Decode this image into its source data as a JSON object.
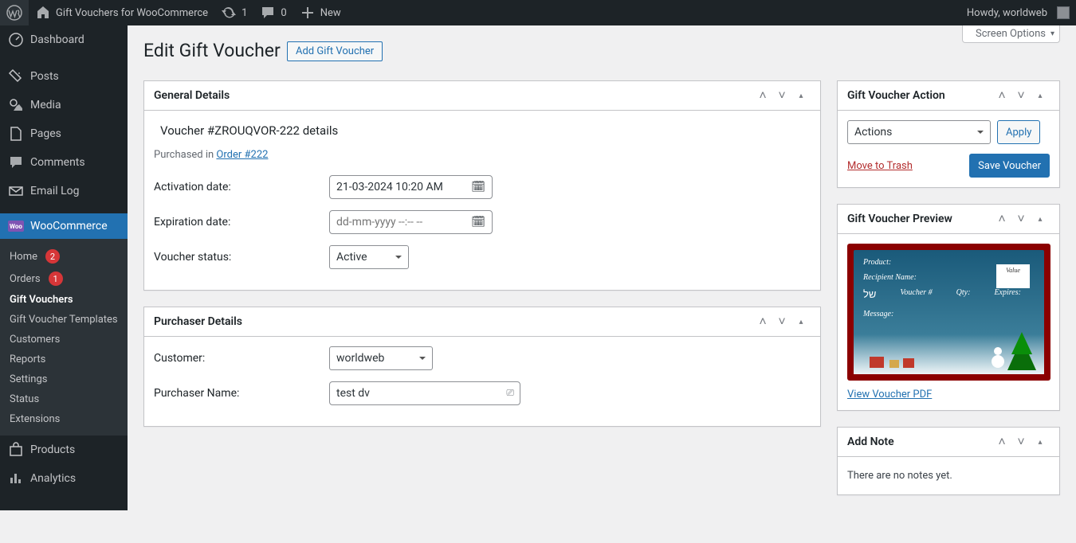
{
  "adminbar": {
    "site_name": "Gift Vouchers for WooCommerce",
    "updates_count": "1",
    "comments_count": "0",
    "new_label": "New",
    "howdy": "Howdy, worldweb"
  },
  "sidebar": {
    "items": [
      {
        "label": "Dashboard"
      },
      {
        "label": "Posts"
      },
      {
        "label": "Media"
      },
      {
        "label": "Pages"
      },
      {
        "label": "Comments"
      },
      {
        "label": "Email Log"
      }
    ],
    "woo_label": "WooCommerce",
    "woo_sub": [
      {
        "label": "Home",
        "badge": "2"
      },
      {
        "label": "Orders",
        "badge": "1"
      },
      {
        "label": "Gift Vouchers"
      },
      {
        "label": "Gift Voucher Templates"
      },
      {
        "label": "Customers"
      },
      {
        "label": "Reports"
      },
      {
        "label": "Settings"
      },
      {
        "label": "Status"
      },
      {
        "label": "Extensions"
      }
    ],
    "products_label": "Products",
    "analytics_label": "Analytics"
  },
  "screen_options": "Screen Options",
  "page": {
    "heading": "Edit Gift Voucher",
    "add_button": "Add Gift Voucher"
  },
  "general": {
    "panel_title": "General Details",
    "voucher_title": "Voucher #ZROUQVOR-222 details",
    "purchased_prefix": "Purchased in ",
    "order_link": "Order #222",
    "activation_label": "Activation date:",
    "activation_value": "21-03-2024 10:20 AM",
    "expiration_label": "Expiration date:",
    "expiration_value": "dd-mm-yyyy --:-- --",
    "status_label": "Voucher status:",
    "status_value": "Active"
  },
  "purchaser": {
    "panel_title": "Purchaser Details",
    "customer_label": "Customer:",
    "customer_value": "worldweb",
    "name_label": "Purchaser Name:",
    "name_value": "test dv"
  },
  "action_box": {
    "title": "Gift Voucher Action",
    "actions_value": "Actions",
    "apply": "Apply",
    "trash": "Move to Trash",
    "save": "Save Voucher"
  },
  "preview_box": {
    "title": "Gift Voucher Preview",
    "pdf_link": "View Voucher PDF",
    "card": {
      "product": "Product:",
      "recipient": "Recipient Name:",
      "voucher": "Voucher #",
      "qty": "Qty:",
      "expires": "Expires:",
      "message": "Message:",
      "value": "Value"
    }
  },
  "note_box": {
    "title": "Add Note",
    "empty": "There are no notes yet."
  }
}
